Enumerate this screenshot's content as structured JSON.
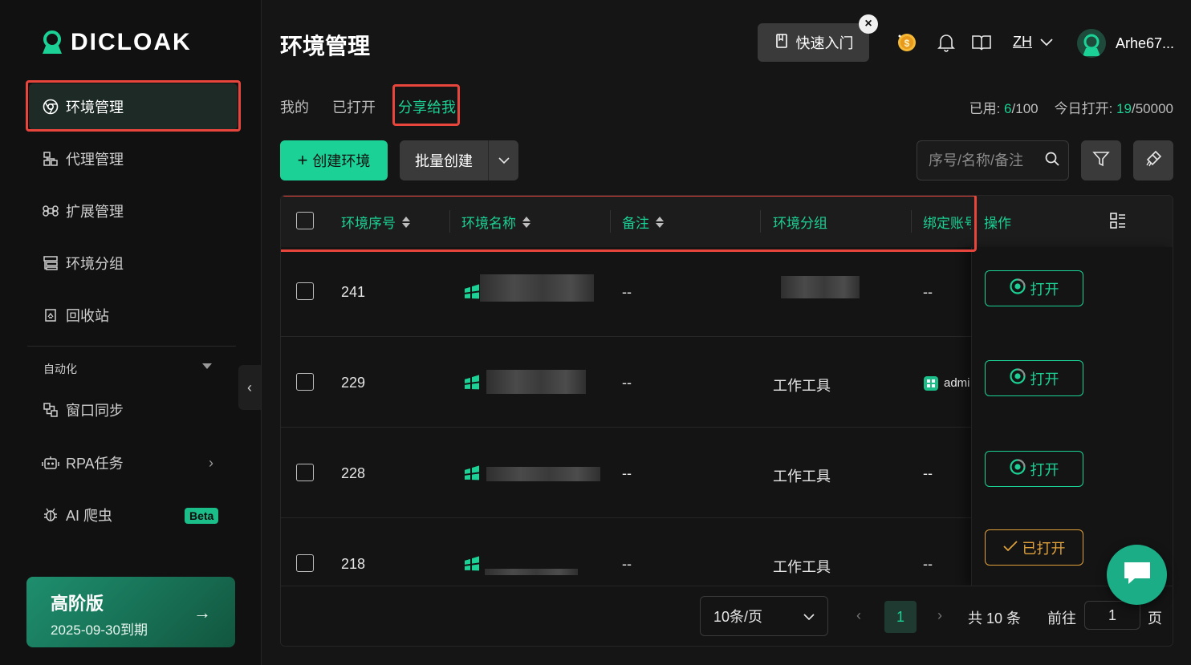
{
  "app": {
    "logo_text": "DICLOAK"
  },
  "sidebar": {
    "items": [
      {
        "label": "环境管理",
        "icon": "chrome-icon"
      },
      {
        "label": "代理管理",
        "icon": "proxy-icon"
      },
      {
        "label": "扩展管理",
        "icon": "command-icon"
      },
      {
        "label": "环境分组",
        "icon": "group-icon"
      },
      {
        "label": "回收站",
        "icon": "recycle-icon"
      }
    ],
    "automation_label": "自动化",
    "auto_items": [
      {
        "label": "窗口同步"
      },
      {
        "label": "RPA任务"
      },
      {
        "label": "AI 爬虫",
        "badge": "Beta"
      }
    ],
    "premium": {
      "title": "高阶版",
      "expiry": "2025-09-30到期",
      "arrow": "→"
    }
  },
  "header": {
    "title": "环境管理",
    "quick_start": "快速入门",
    "language": "ZH",
    "username": "Arhe67..."
  },
  "tabs": [
    {
      "label": "我的"
    },
    {
      "label": "已打开"
    },
    {
      "label": "分享给我"
    }
  ],
  "stats": {
    "used_label": "已用:",
    "used": "6",
    "used_total": "/100",
    "today_label": "今日打开:",
    "today": "19",
    "today_total": "/50000"
  },
  "toolbar": {
    "create_label": "创建环境",
    "batch_label": "批量创建",
    "search_placeholder": "序号/名称/备注"
  },
  "table": {
    "columns": [
      "环境序号",
      "环境名称",
      "备注",
      "环境分组",
      "绑定账号",
      "操作"
    ],
    "rows": [
      {
        "id": "241",
        "note": "--",
        "group": "",
        "account": "--",
        "action": "打开"
      },
      {
        "id": "229",
        "note": "--",
        "group": "工作工具",
        "account": "admi",
        "action": "打开"
      },
      {
        "id": "228",
        "note": "--",
        "group": "工作工具",
        "account": "--",
        "action": "打开"
      },
      {
        "id": "218",
        "note": "--",
        "group": "工作工具",
        "account": "--",
        "action": "已打开"
      }
    ]
  },
  "pagination": {
    "page_size": "10条/页",
    "current_page": "1",
    "total": "共 10 条",
    "goto_label": "前往",
    "goto_value": "1",
    "goto_suffix": "页"
  },
  "colors": {
    "accent": "#1bd195",
    "warning": "#e0a13a",
    "highlight": "#e8453c"
  }
}
